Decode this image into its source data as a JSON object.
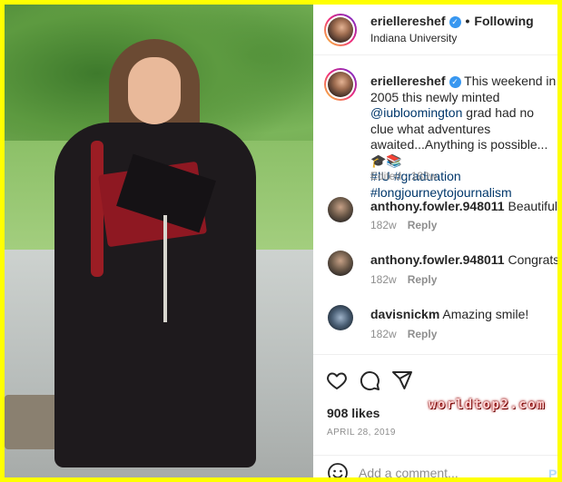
{
  "colors": {
    "border": "#ffff00",
    "verified": "#3897f0",
    "link": "#00376b",
    "muted": "#8e8e8e",
    "post_button": "#b3dbff"
  },
  "header": {
    "username": "eriellereshef",
    "separator": "•",
    "follow_status": "Following",
    "location": "Indiana University"
  },
  "caption": {
    "username": "eriellereshef",
    "text_before_mention": "This weekend in 2005 this newly minted",
    "mention": "@iubloomington",
    "text_after_mention": "grad had no clue what adventures awaited...Anything is possible...",
    "emojis": "🎓📚",
    "hashtags": [
      "#IU",
      "#graduation",
      "#longjourneytojournalism"
    ],
    "meta": "Edited · 183w"
  },
  "comments": [
    {
      "username": "anthony.fowler.948011",
      "text": "Beautiful",
      "age": "182w",
      "reply_label": "Reply"
    },
    {
      "username": "anthony.fowler.948011",
      "text": "Congrats",
      "age": "182w",
      "reply_label": "Reply"
    },
    {
      "username": "davisnickm",
      "text": "Amazing smile!",
      "age": "182w",
      "reply_label": "Reply"
    }
  ],
  "actions": {
    "icons": [
      "heart-icon",
      "comment-icon",
      "share-icon",
      "bookmark-icon"
    ],
    "likes": "908 likes",
    "date": "APRIL 28, 2019"
  },
  "comment_bar": {
    "emoji_icon": "smile-icon",
    "placeholder": "Add a comment...",
    "post_label": "P"
  },
  "watermark": "worldtop2.com"
}
